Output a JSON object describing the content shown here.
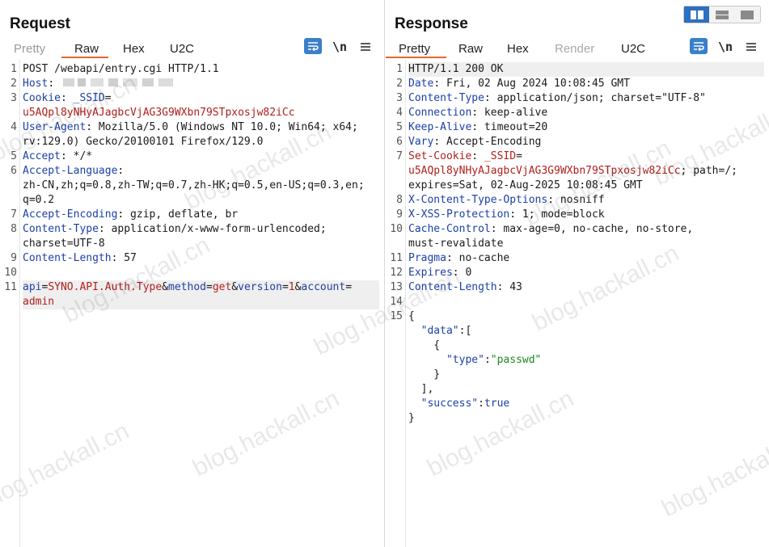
{
  "request": {
    "title": "Request",
    "tabs": [
      "Pretty",
      "Raw",
      "Hex",
      "U2C"
    ],
    "active_tab": "Raw",
    "newline_label": "\\n",
    "lines": [
      {
        "n": "1",
        "parts": [
          {
            "t": "POST /webapi/entry.cgi HTTP/1.1",
            "c": "v"
          }
        ]
      },
      {
        "n": "2",
        "parts": [
          {
            "t": "Host",
            "c": "k"
          },
          {
            "t": ": ",
            "c": "v"
          }
        ]
      },
      {
        "n": "3",
        "parts": [
          {
            "t": "Cookie",
            "c": "k"
          },
          {
            "t": ": ",
            "c": "v"
          },
          {
            "t": "_SSID",
            "c": "k"
          },
          {
            "t": "=",
            "c": "v"
          }
        ]
      },
      {
        "n": "",
        "parts": [
          {
            "t": "u5AQpl8yNHyAJagbcVjAG3G9WXbn79STpxosjw82iCc",
            "c": "r"
          }
        ]
      },
      {
        "n": "4",
        "parts": [
          {
            "t": "User-Agent",
            "c": "k"
          },
          {
            "t": ": Mozilla/5.0 (Windows NT 10.0; Win64; x64;",
            "c": "v"
          }
        ]
      },
      {
        "n": "",
        "parts": [
          {
            "t": "rv:129.0) Gecko/20100101 Firefox/129.0",
            "c": "v"
          }
        ]
      },
      {
        "n": "5",
        "parts": [
          {
            "t": "Accept",
            "c": "k"
          },
          {
            "t": ": */*",
            "c": "v"
          }
        ]
      },
      {
        "n": "6",
        "parts": [
          {
            "t": "Accept-Language",
            "c": "k"
          },
          {
            "t": ":",
            "c": "v"
          }
        ]
      },
      {
        "n": "",
        "parts": [
          {
            "t": "zh-CN,zh;q=0.8,zh-TW;q=0.7,zh-HK;q=0.5,en-US;q=0.3,en;",
            "c": "v"
          }
        ]
      },
      {
        "n": "",
        "parts": [
          {
            "t": "q=0.2",
            "c": "v"
          }
        ]
      },
      {
        "n": "7",
        "parts": [
          {
            "t": "Accept-Encoding",
            "c": "k"
          },
          {
            "t": ": gzip, deflate, br",
            "c": "v"
          }
        ]
      },
      {
        "n": "8",
        "parts": [
          {
            "t": "Content-Type",
            "c": "k"
          },
          {
            "t": ": application/x-www-form-urlencoded;",
            "c": "v"
          }
        ]
      },
      {
        "n": "",
        "parts": [
          {
            "t": "charset=UTF-8",
            "c": "v"
          }
        ]
      },
      {
        "n": "9",
        "parts": [
          {
            "t": "Content-Length",
            "c": "k"
          },
          {
            "t": ": 57",
            "c": "v"
          }
        ]
      },
      {
        "n": "10",
        "parts": []
      },
      {
        "n": "11",
        "hl": true,
        "parts": [
          {
            "t": "api",
            "c": "k"
          },
          {
            "t": "=",
            "c": "v"
          },
          {
            "t": "SYNO.API.Auth.Type",
            "c": "r"
          },
          {
            "t": "&",
            "c": "v"
          },
          {
            "t": "method",
            "c": "k"
          },
          {
            "t": "=",
            "c": "v"
          },
          {
            "t": "get",
            "c": "r"
          },
          {
            "t": "&",
            "c": "v"
          },
          {
            "t": "version",
            "c": "k"
          },
          {
            "t": "=",
            "c": "v"
          },
          {
            "t": "1",
            "c": "r"
          },
          {
            "t": "&",
            "c": "v"
          },
          {
            "t": "account",
            "c": "k"
          },
          {
            "t": "=",
            "c": "v"
          }
        ]
      },
      {
        "n": "",
        "hl": true,
        "parts": [
          {
            "t": "admin",
            "c": "r"
          }
        ]
      }
    ]
  },
  "response": {
    "title": "Response",
    "tabs": [
      "Pretty",
      "Raw",
      "Hex",
      "Render",
      "U2C"
    ],
    "active_tab": "Pretty",
    "newline_label": "\\n",
    "lines": [
      {
        "n": "1",
        "hl": true,
        "parts": [
          {
            "t": "HTTP/1.1 200 OK",
            "c": "v"
          }
        ]
      },
      {
        "n": "2",
        "parts": [
          {
            "t": "Date",
            "c": "k"
          },
          {
            "t": ": Fri, 02 Aug 2024 10:08:45 GMT",
            "c": "v"
          }
        ]
      },
      {
        "n": "3",
        "parts": [
          {
            "t": "Content-Type",
            "c": "k"
          },
          {
            "t": ": application/json; charset=\"UTF-8\"",
            "c": "v"
          }
        ]
      },
      {
        "n": "4",
        "parts": [
          {
            "t": "Connection",
            "c": "k"
          },
          {
            "t": ": keep-alive",
            "c": "v"
          }
        ]
      },
      {
        "n": "5",
        "parts": [
          {
            "t": "Keep-Alive",
            "c": "k"
          },
          {
            "t": ": timeout=20",
            "c": "v"
          }
        ]
      },
      {
        "n": "6",
        "parts": [
          {
            "t": "Vary",
            "c": "k"
          },
          {
            "t": ": Accept-Encoding",
            "c": "v"
          }
        ]
      },
      {
        "n": "7",
        "parts": [
          {
            "t": "Set-Cookie",
            "c": "r"
          },
          {
            "t": ": ",
            "c": "v"
          },
          {
            "t": "_SSID",
            "c": "r"
          },
          {
            "t": "=",
            "c": "v"
          }
        ]
      },
      {
        "n": "",
        "parts": [
          {
            "t": "u5AQpl8yNHyAJagbcVjAG3G9WXbn79STpxosjw82iCc",
            "c": "r"
          },
          {
            "t": "; path=/;",
            "c": "v"
          }
        ]
      },
      {
        "n": "",
        "parts": [
          {
            "t": "expires=Sat, 02-Aug-2025 10:08:45 GMT",
            "c": "v"
          }
        ]
      },
      {
        "n": "8",
        "parts": [
          {
            "t": "X-Content-Type-Options",
            "c": "k"
          },
          {
            "t": ": nosniff",
            "c": "v"
          }
        ]
      },
      {
        "n": "9",
        "parts": [
          {
            "t": "X-XSS-Protection",
            "c": "k"
          },
          {
            "t": ": 1; mode=block",
            "c": "v"
          }
        ]
      },
      {
        "n": "10",
        "parts": [
          {
            "t": "Cache-Control",
            "c": "k"
          },
          {
            "t": ": max-age=0, no-cache, no-store,",
            "c": "v"
          }
        ]
      },
      {
        "n": "",
        "parts": [
          {
            "t": "must-revalidate",
            "c": "v"
          }
        ]
      },
      {
        "n": "11",
        "parts": [
          {
            "t": "Pragma",
            "c": "k"
          },
          {
            "t": ": no-cache",
            "c": "v"
          }
        ]
      },
      {
        "n": "12",
        "parts": [
          {
            "t": "Expires",
            "c": "k"
          },
          {
            "t": ": 0",
            "c": "v"
          }
        ]
      },
      {
        "n": "13",
        "parts": [
          {
            "t": "Content-Length",
            "c": "k"
          },
          {
            "t": ": 43",
            "c": "v"
          }
        ]
      },
      {
        "n": "14",
        "parts": []
      },
      {
        "n": "15",
        "parts": [
          {
            "t": "{",
            "c": "v"
          }
        ]
      },
      {
        "n": "",
        "parts": [
          {
            "t": "  ",
            "c": "v"
          },
          {
            "t": "\"data\"",
            "c": "k"
          },
          {
            "t": ":[",
            "c": "v"
          }
        ]
      },
      {
        "n": "",
        "parts": [
          {
            "t": "    {",
            "c": "v"
          }
        ]
      },
      {
        "n": "",
        "parts": [
          {
            "t": "      ",
            "c": "v"
          },
          {
            "t": "\"type\"",
            "c": "k"
          },
          {
            "t": ":",
            "c": "v"
          },
          {
            "t": "\"passwd\"",
            "c": "s"
          }
        ]
      },
      {
        "n": "",
        "parts": [
          {
            "t": "    }",
            "c": "v"
          }
        ]
      },
      {
        "n": "",
        "parts": [
          {
            "t": "  ],",
            "c": "v"
          }
        ]
      },
      {
        "n": "",
        "parts": [
          {
            "t": "  ",
            "c": "v"
          },
          {
            "t": "\"success\"",
            "c": "k"
          },
          {
            "t": ":",
            "c": "v"
          },
          {
            "t": "true",
            "c": "k"
          }
        ]
      },
      {
        "n": "",
        "parts": [
          {
            "t": "}",
            "c": "v"
          }
        ]
      }
    ]
  },
  "view_toggle": [
    "split-vertical-icon",
    "split-horizontal-icon",
    "single-pane-icon"
  ],
  "watermark_text": "blog.hackall.cn",
  "colors": {
    "accent": "#e8652b",
    "header_key": "#1c3fa8",
    "value_red": "#b0201d",
    "json_string": "#1b8a1f",
    "toggle_active": "#2d6fc0"
  }
}
